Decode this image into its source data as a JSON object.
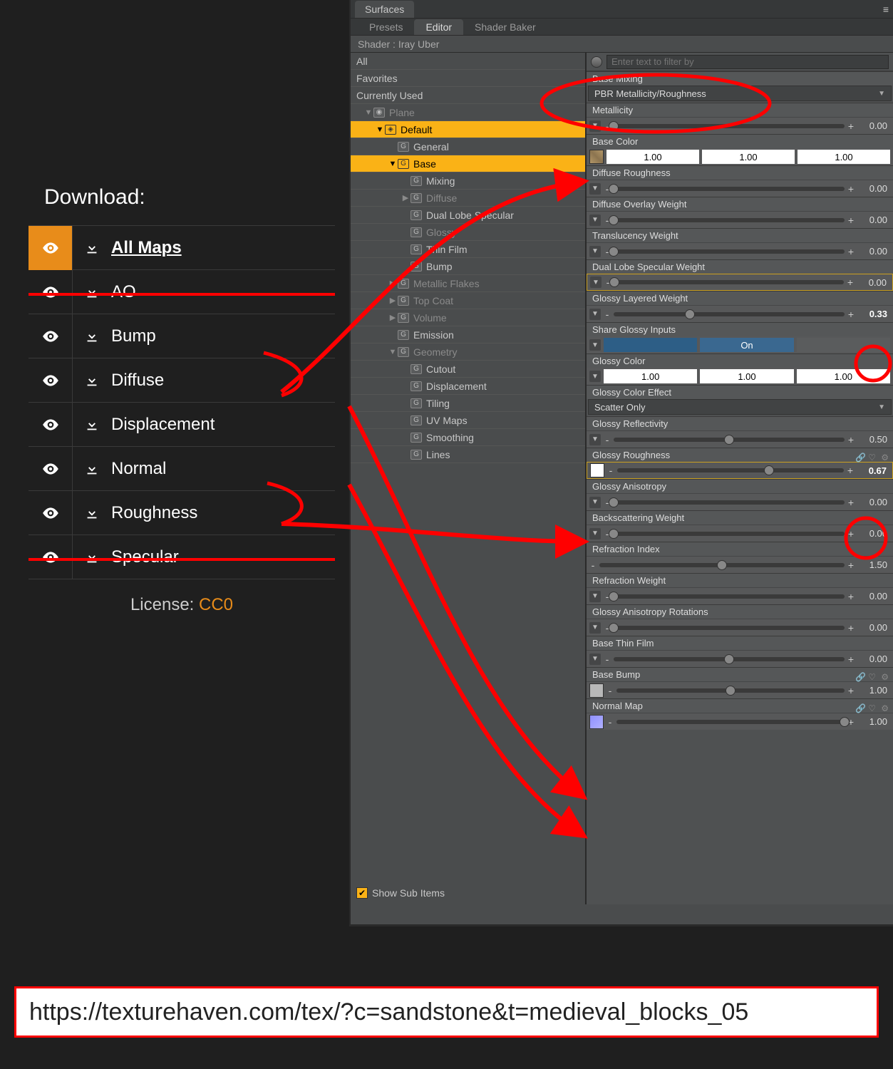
{
  "download": {
    "title": "Download:",
    "items": [
      {
        "label": "All Maps",
        "header": true,
        "eye_active": true
      },
      {
        "label": "AO"
      },
      {
        "label": "Bump"
      },
      {
        "label": "Diffuse"
      },
      {
        "label": "Displacement"
      },
      {
        "label": "Normal"
      },
      {
        "label": "Roughness"
      },
      {
        "label": "Specular"
      }
    ],
    "license_label": "License: ",
    "license_value": "CC0"
  },
  "surfaces": {
    "main_tab": "Surfaces",
    "sub_tabs": {
      "presets": "Presets",
      "editor": "Editor",
      "shader_baker": "Shader Baker"
    },
    "shader_line": "Shader : Iray Uber",
    "filters": {
      "all": "All",
      "favorites": "Favorites",
      "currently_used": "Currently Used"
    },
    "tree": {
      "plane": "Plane",
      "default": "Default",
      "general": "General",
      "base": "Base",
      "mixing": "Mixing",
      "diffuse": "Diffuse",
      "dual_lobe": "Dual Lobe Specular",
      "glossy": "Glossy",
      "thin_film": "Thin Film",
      "bump": "Bump",
      "metallic_flakes": "Metallic Flakes",
      "top_coat": "Top Coat",
      "volume": "Volume",
      "emission": "Emission",
      "geometry": "Geometry",
      "cutout": "Cutout",
      "displacement": "Displacement",
      "tiling": "Tiling",
      "uv_maps": "UV Maps",
      "smoothing": "Smoothing",
      "lines": "Lines"
    },
    "show_sub": "Show Sub Items",
    "filter_placeholder": "Enter text to filter by",
    "base_mixing": {
      "label": "Base Mixing",
      "value": "PBR Metallicity/Roughness"
    },
    "props": {
      "metallicity": {
        "label": "Metallicity",
        "val": "0.00"
      },
      "base_color": {
        "label": "Base Color",
        "r": "1.00",
        "g": "1.00",
        "b": "1.00"
      },
      "diffuse_roughness": {
        "label": "Diffuse Roughness",
        "val": "0.00"
      },
      "diffuse_overlay": {
        "label": "Diffuse Overlay Weight",
        "val": "0.00"
      },
      "translucency": {
        "label": "Translucency Weight",
        "val": "0.00"
      },
      "dual_lobe": {
        "label": "Dual Lobe Specular Weight",
        "val": "0.00"
      },
      "glossy_layered": {
        "label": "Glossy Layered Weight",
        "val": "0.33"
      },
      "share_glossy": {
        "label": "Share Glossy Inputs",
        "on": "On"
      },
      "glossy_color": {
        "label": "Glossy Color",
        "r": "1.00",
        "g": "1.00",
        "b": "1.00"
      },
      "glossy_color_effect": {
        "label": "Glossy Color Effect",
        "value": "Scatter Only"
      },
      "glossy_reflectivity": {
        "label": "Glossy Reflectivity",
        "val": "0.50"
      },
      "glossy_roughness": {
        "label": "Glossy Roughness",
        "val": "0.67"
      },
      "glossy_anisotropy": {
        "label": "Glossy Anisotropy",
        "val": "0.00"
      },
      "backscattering": {
        "label": "Backscattering Weight",
        "val": "0.00"
      },
      "refraction_index": {
        "label": "Refraction Index",
        "val": "1.50"
      },
      "refraction_weight": {
        "label": "Refraction Weight",
        "val": "0.00"
      },
      "glossy_aniso_rot": {
        "label": "Glossy Anisotropy Rotations",
        "val": "0.00"
      },
      "base_thin_film": {
        "label": "Base Thin Film",
        "val": "0.00"
      },
      "base_bump": {
        "label": "Base Bump",
        "val": "1.00"
      },
      "normal_map": {
        "label": "Normal Map",
        "val": "1.00"
      }
    }
  },
  "url": "https://texturehaven.com/tex/?c=sandstone&t=medieval_blocks_05"
}
